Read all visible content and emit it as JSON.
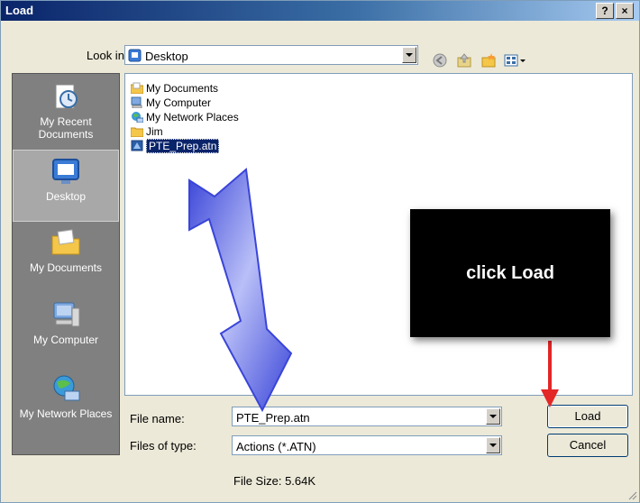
{
  "window": {
    "title": "Load",
    "help_btn": "?",
    "close_btn": "×"
  },
  "look_in": {
    "label": "Look in:",
    "value": "Desktop"
  },
  "toolbar": {
    "icons": [
      "back-icon",
      "up-folder-icon",
      "new-folder-icon",
      "view-menu-icon"
    ]
  },
  "places": [
    {
      "label": "My Recent Documents",
      "icon": "recent-documents-icon"
    },
    {
      "label": "Desktop",
      "icon": "desktop-icon",
      "selected": true
    },
    {
      "label": "My Documents",
      "icon": "my-documents-icon"
    },
    {
      "label": "My Computer",
      "icon": "my-computer-icon"
    },
    {
      "label": "My Network Places",
      "icon": "network-places-icon"
    }
  ],
  "files": [
    {
      "name": "My Documents",
      "icon": "folder-documents-icon"
    },
    {
      "name": "My Computer",
      "icon": "computer-icon"
    },
    {
      "name": "My Network Places",
      "icon": "network-icon"
    },
    {
      "name": "Jim",
      "icon": "folder-icon"
    },
    {
      "name": "PTE_Prep.atn",
      "icon": "actions-file-icon",
      "selected": true
    }
  ],
  "file_name": {
    "label": "File name:",
    "value": "PTE_Prep.atn"
  },
  "file_type": {
    "label": "Files of type:",
    "value": "Actions (*.ATN)"
  },
  "buttons": {
    "load": "Load",
    "cancel": "Cancel"
  },
  "file_size": "File Size: 5.64K",
  "annotation": {
    "callout_text": "click Load",
    "arrow_color": "#e32626",
    "big_arrow_color": "#8e96f0"
  }
}
